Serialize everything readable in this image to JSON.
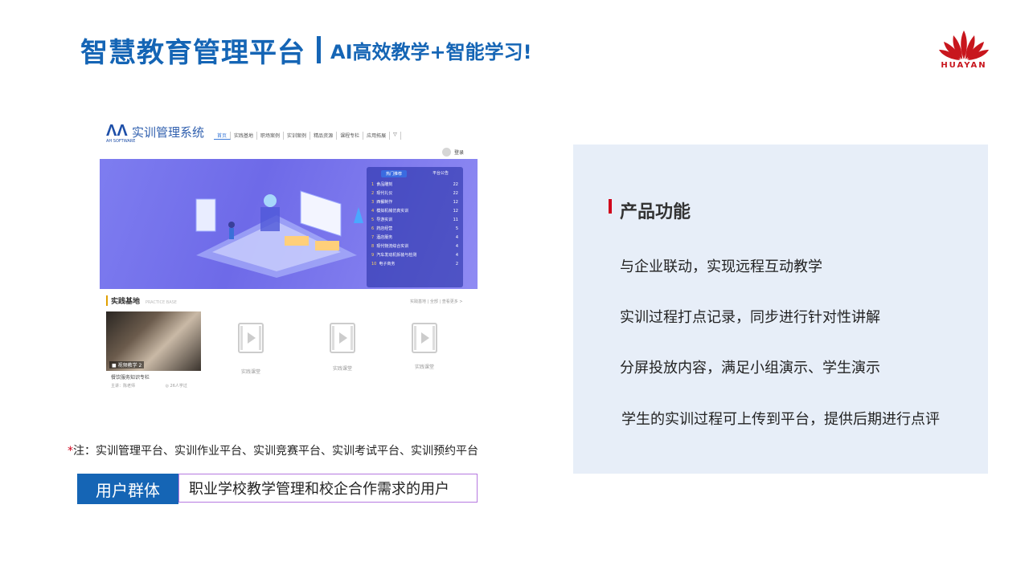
{
  "header": {
    "title": "智慧教育管理平台",
    "subtitle": "AI高效教学+智能学习!"
  },
  "logo": {
    "text": "HUAYAN",
    "color": "#c8161d"
  },
  "screenshot": {
    "app_logo": "ΛΛ",
    "app_logo_sub": "AH SOFTWARE",
    "app_title": "实训管理系统",
    "nav": [
      "首页",
      "实践基地",
      "职场案例",
      "实训案例",
      "精品资源",
      "课程专栏",
      "应用拓展",
      "▽"
    ],
    "login": "登录",
    "rank_tabs": [
      "热门推荐",
      "平台公告"
    ],
    "rank_items": [
      {
        "no": "1",
        "name": "食品雕刻",
        "count": "22"
      },
      {
        "no": "2",
        "name": "现代礼仪",
        "count": "22"
      },
      {
        "no": "3",
        "name": "西餐制作",
        "count": "12"
      },
      {
        "no": "4",
        "name": "模拟机械仿真实训",
        "count": "12"
      },
      {
        "no": "5",
        "name": "导游实训",
        "count": "11"
      },
      {
        "no": "6",
        "name": "药店经营",
        "count": "5"
      },
      {
        "no": "7",
        "name": "酒店服务",
        "count": "4"
      },
      {
        "no": "8",
        "name": "现代物流综合实训",
        "count": "4"
      },
      {
        "no": "9",
        "name": "汽车发动机拆装与检测",
        "count": "4"
      },
      {
        "no": "10",
        "name": "电子商务",
        "count": "2"
      }
    ],
    "section_title": "实践基地",
    "section_subtitle": "PRACTICE BASE",
    "section_more": "实践基地 | 全部 | 查看更多 >",
    "first_card": {
      "photo_label": "■ 视频教学 2",
      "name": "餐饮服务知识专栏",
      "author": "主讲：陈老师",
      "views": "◎ 26人学过"
    },
    "placeholder_caption": "实践课堂"
  },
  "note": {
    "star": "*",
    "text": "注：实训管理平台、实训作业平台、实训竞赛平台、实训考试平台、实训预约平台"
  },
  "user_group": {
    "label": "用户群体",
    "value": "职业学校教学管理和校企合作需求的用户"
  },
  "panel": {
    "title": "产品功能",
    "features": [
      "与企业联动，实现远程互动教学",
      "实训过程打点记录，同步进行针对性讲解",
      "分屏投放内容，满足小组演示、学生演示",
      "学生的实训过程可上传到平台，提供后期进行点评"
    ]
  },
  "colors": {
    "brand_blue": "#1565b5",
    "accent_red": "#d0021b",
    "panel_bg": "#e7eef8",
    "border_purple": "#b679e0"
  }
}
